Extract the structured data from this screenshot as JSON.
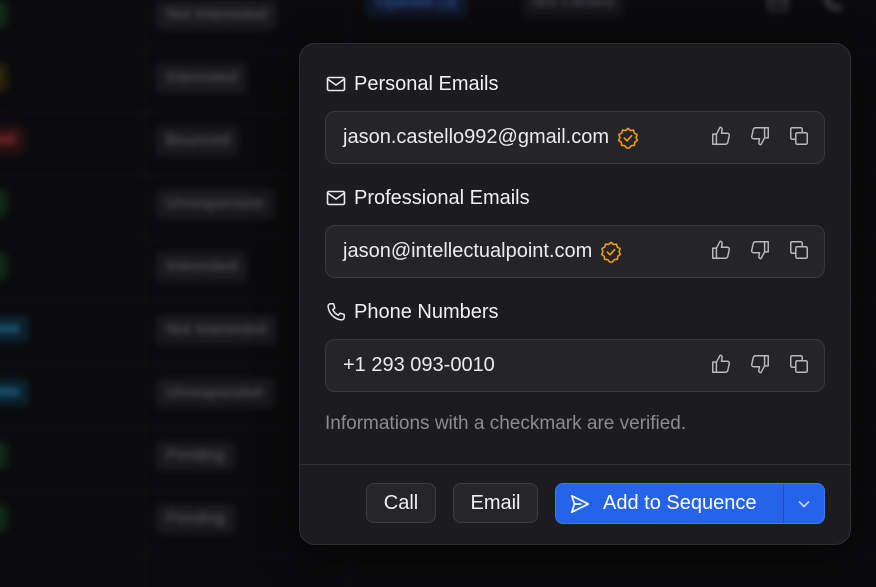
{
  "background": {
    "rows": [
      {
        "status": "ed",
        "status_color": "#22c55e",
        "tag": "Not Interested"
      },
      {
        "status": "ed",
        "status_color": "#eab308",
        "tag": "Interested"
      },
      {
        "status": "nced",
        "status_color": "#ef4444",
        "tag": "Bounced"
      },
      {
        "status": "ed",
        "status_color": "#22c55e",
        "tag": "Unresponsive"
      },
      {
        "status": "ed",
        "status_color": "#22c55e",
        "tag": "Interested"
      },
      {
        "status": "gress",
        "status_color": "#38bdf8",
        "tag": "Not Interested"
      },
      {
        "status": "gress",
        "status_color": "#38bdf8",
        "tag": "Unresponsive"
      },
      {
        "status": "ed",
        "status_color": "#22c55e",
        "tag": "Pending"
      },
      {
        "status": "ed",
        "status_color": "#22c55e",
        "tag": "Pending"
      }
    ],
    "opened_label": "Opened (3)",
    "clicked_label": "Not Clicked"
  },
  "popover": {
    "personal": {
      "title": "Personal Emails",
      "value": "jason.castello992@gmail.com",
      "verified": true
    },
    "professional": {
      "title": "Professional Emails",
      "value": "jason@intellectualpoint.com",
      "verified": true
    },
    "phone": {
      "title": "Phone Numbers",
      "value": "+1 293 093-0010",
      "verified": false
    },
    "hint": "Informations with a checkmark are verified.",
    "buttons": {
      "call": "Call",
      "email": "Email",
      "add_to_sequence": "Add to Sequence"
    }
  },
  "colors": {
    "accent": "#2563eb",
    "verified": "#f59e0b"
  }
}
